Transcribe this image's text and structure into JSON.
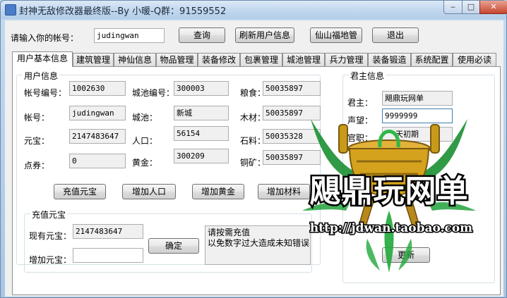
{
  "window": {
    "title": "封神无敌修改器最终版--By 小暖-Q群：91559552",
    "min_glyph": "‒",
    "max_glyph": "□",
    "close_glyph": "✕"
  },
  "toolbar": {
    "account_label": "请输入你的帐号：",
    "account_value": "judingwan",
    "query_button": "查询",
    "refresh_button": "刷新用户信息",
    "paradise_button": "仙山福地管",
    "exit_button": "退出"
  },
  "tabs": [
    "用户基本信息",
    "建筑管理",
    "神仙信息",
    "物品管理",
    "装备修改",
    "包裹管理",
    "城池管理",
    "兵力管理",
    "装备锻造",
    "系统配置",
    "使用必读"
  ],
  "user_info": {
    "group_title": "用户信息",
    "fields": {
      "account_no_label": "帐号编号：",
      "account_no": "1002630",
      "city_no_label": "城池编号：",
      "city_no": "300003",
      "grain_label": "粮食：",
      "grain": "50035897",
      "account_label": "帐号：",
      "account": "judingwan",
      "city_label": "城池：",
      "city": "新城",
      "wood_label": "木材：",
      "wood": "50035897",
      "yuanbao_label": "元宝：",
      "yuanbao": "2147483647",
      "population_label": "人口：",
      "population": "56154",
      "stone_label": "石料：",
      "stone": "50035328",
      "coupon_label": "点券：",
      "coupon": "0",
      "gold_label": "黄金：",
      "gold": "300209",
      "copper_label": "铜矿：",
      "copper": "50035897"
    },
    "buttons": {
      "recharge_yuanbao": "充值元宝",
      "add_population": "增加人口",
      "add_gold": "增加黄金",
      "add_material": "增加材料"
    }
  },
  "recharge": {
    "group_title": "充值元宝",
    "current_label": "现有元宝：",
    "current_value": "2147483647",
    "add_label": "增加元宝：",
    "add_value": "",
    "confirm_button": "确定",
    "note": "请按需充值\n以免数字过大造成未知错误"
  },
  "lord_info": {
    "group_title": "君主信息",
    "lord_label": "君主：",
    "lord_value": "飓鼎玩网单",
    "prestige_label": "声望：",
    "prestige_value": "9999999",
    "rank_label": "官职：",
    "rank_value": "天初期",
    "update_button": "更新"
  },
  "watermark": {
    "brand": "飓鼎玩网单",
    "url": "http://jdwan.taobao.com"
  },
  "colors": {
    "titlebar": "#c2d8ef",
    "client_bg": "#f0f0f0",
    "watermark_green": "#1fa83a",
    "watermark_gold": "#d4a21c"
  }
}
